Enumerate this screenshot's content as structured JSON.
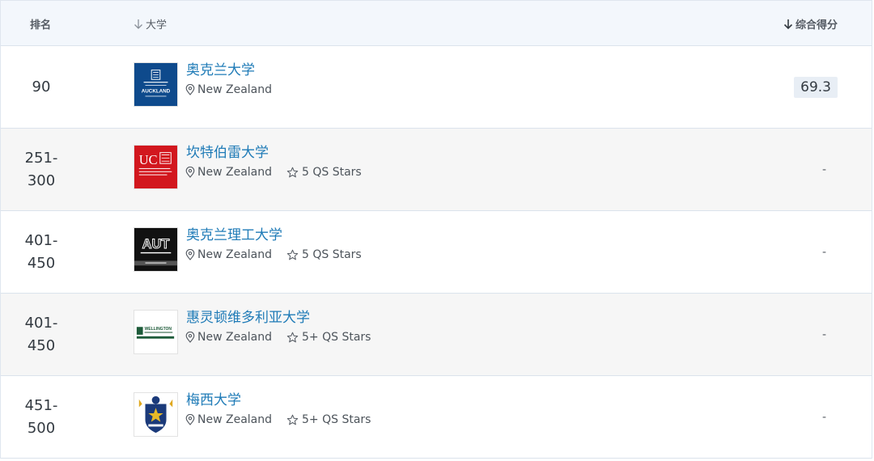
{
  "header": {
    "rank_label": "排名",
    "university_label": "大学",
    "score_label": "综合得分"
  },
  "rows": [
    {
      "rank": "90",
      "name": "奥克兰大学",
      "country": "New Zealand",
      "stars": "",
      "score": "69.3"
    },
    {
      "rank": "251-\n300",
      "name": "坎特伯雷大学",
      "country": "New Zealand",
      "stars": "5 QS Stars",
      "score": "-"
    },
    {
      "rank": "401-\n450",
      "name": "奥克兰理工大学",
      "country": "New Zealand",
      "stars": "5 QS Stars",
      "score": "-"
    },
    {
      "rank": "401-\n450",
      "name": "惠灵顿维多利亚大学",
      "country": "New Zealand",
      "stars": "5+ QS Stars",
      "score": "-"
    },
    {
      "rank": "451-\n500",
      "name": "梅西大学",
      "country": "New Zealand",
      "stars": "5+ QS Stars",
      "score": "-"
    }
  ],
  "logos": {
    "auckland_text": "AUCKLAND",
    "canterbury_text": "UC",
    "aut_text": "AUT",
    "wellington_text": "WELLINGTON"
  },
  "colors": {
    "link": "#1f7bb7",
    "header_bg": "#f3f7fc",
    "alt_row_bg": "#f6f6f6",
    "score_pill_bg": "#e8eef5",
    "auckland_blue": "#0e4a8c",
    "canterbury_red": "#d2171e",
    "aut_black": "#111111",
    "massey_blue": "#1b3a7a"
  }
}
